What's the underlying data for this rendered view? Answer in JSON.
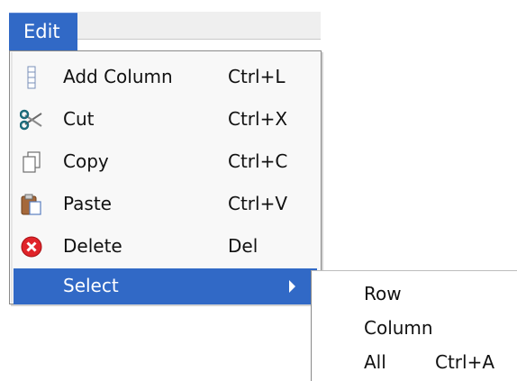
{
  "menubar": {
    "edit_label": "Edit"
  },
  "menu": {
    "items": [
      {
        "label": "Add Column",
        "shortcut": "Ctrl+L",
        "icon": "column-icon"
      },
      {
        "label": "Cut",
        "shortcut": "Ctrl+X",
        "icon": "scissors-icon"
      },
      {
        "label": "Copy",
        "shortcut": "Ctrl+C",
        "icon": "copy-icon"
      },
      {
        "label": "Paste",
        "shortcut": "Ctrl+V",
        "icon": "paste-icon"
      },
      {
        "label": "Delete",
        "shortcut": "Del",
        "icon": "delete-icon"
      },
      {
        "label": "Select",
        "shortcut": "",
        "icon": ""
      }
    ],
    "selected_label": "Select"
  },
  "submenu": {
    "items": [
      {
        "label": "Row",
        "shortcut": ""
      },
      {
        "label": "Column",
        "shortcut": ""
      },
      {
        "label": "All",
        "shortcut": "Ctrl+A"
      }
    ]
  },
  "colors": {
    "highlight": "#3169c6",
    "menu_bg": "#f8f8f8",
    "border": "#8a8a8a",
    "delete_red": "#e0242a"
  }
}
